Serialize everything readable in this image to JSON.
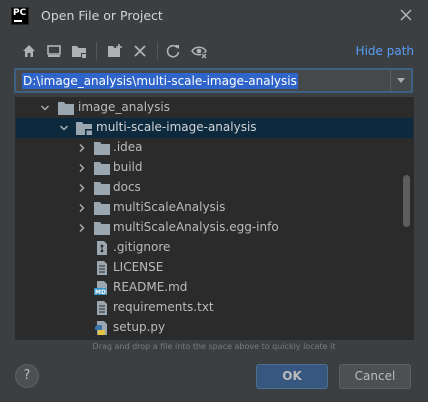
{
  "window": {
    "title": "Open File or Project",
    "logo_text": "PC"
  },
  "toolbar": {
    "icons": [
      "home-icon",
      "desktop-icon",
      "project-folder-icon",
      "new-folder-icon",
      "delete-icon",
      "refresh-icon",
      "show-hidden-icon"
    ],
    "hide_path_label": "Hide path"
  },
  "path": {
    "value": "D:\\image_analysis\\multi-scale-image-analysis"
  },
  "tree": {
    "items": [
      {
        "label": "image_analysis",
        "type": "folder",
        "expanded": true
      },
      {
        "label": "multi-scale-image-analysis",
        "type": "project-folder",
        "expanded": true,
        "selected": true
      },
      {
        "label": ".idea",
        "type": "folder",
        "expanded": false
      },
      {
        "label": "build",
        "type": "folder",
        "expanded": false
      },
      {
        "label": "docs",
        "type": "folder",
        "expanded": false
      },
      {
        "label": "multiScaleAnalysis",
        "type": "folder",
        "expanded": false
      },
      {
        "label": "multiScaleAnalysis.egg-info",
        "type": "folder",
        "expanded": false
      },
      {
        "label": ".gitignore",
        "type": "gitignore-file"
      },
      {
        "label": "LICENSE",
        "type": "text-file"
      },
      {
        "label": "README.md",
        "type": "markdown-file",
        "icon_text": "MD"
      },
      {
        "label": "requirements.txt",
        "type": "text-file"
      },
      {
        "label": "setup.py",
        "type": "python-file"
      }
    ]
  },
  "footer": {
    "drag_hint": "Drag and drop a file into the space above to quickly locate it",
    "help_label": "?",
    "ok_label": "OK",
    "cancel_label": "Cancel"
  },
  "colors": {
    "background": "#3c3f41",
    "tree_background": "#2b2b2b",
    "selection": "#0d293e",
    "accent_link": "#589df6",
    "ok_button": "#365880",
    "folder_icon": "#9aa7b0"
  }
}
